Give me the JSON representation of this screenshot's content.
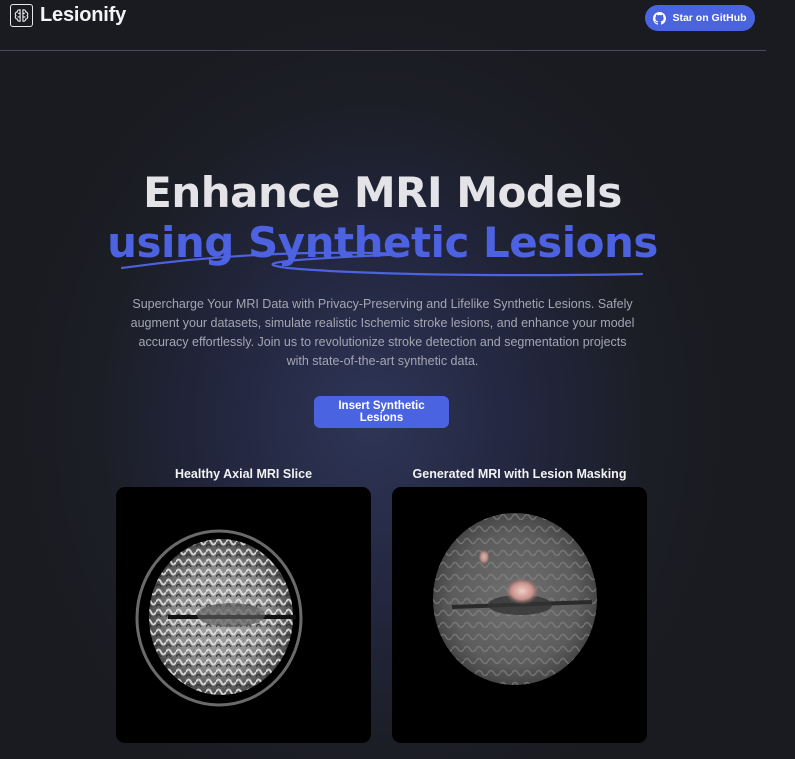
{
  "nav": {
    "brand": "Lesionify",
    "github_label": "Star on GitHub"
  },
  "hero": {
    "title_line1": "Enhance MRI Models",
    "title_line2": "using Synthetic Lesions",
    "subtitle": "Supercharge Your MRI Data with Privacy-Preserving and Lifelike Synthetic Lesions. Safely augment your datasets, simulate realistic Ischemic stroke lesions, and enhance your model accuracy effortlessly. Join us to revolutionize stroke detection and segmentation projects with state-of-the-art synthetic data.",
    "cta_label": "Insert Synthetic Lesions"
  },
  "cards": {
    "left_label": "Healthy Axial MRI Slice",
    "right_label": "Generated MRI with Lesion Masking"
  },
  "colors": {
    "accent": "#4a63e0",
    "background": "#1c1e27",
    "title": "#e3e3e8",
    "subtitle": "#a4a6b3"
  }
}
